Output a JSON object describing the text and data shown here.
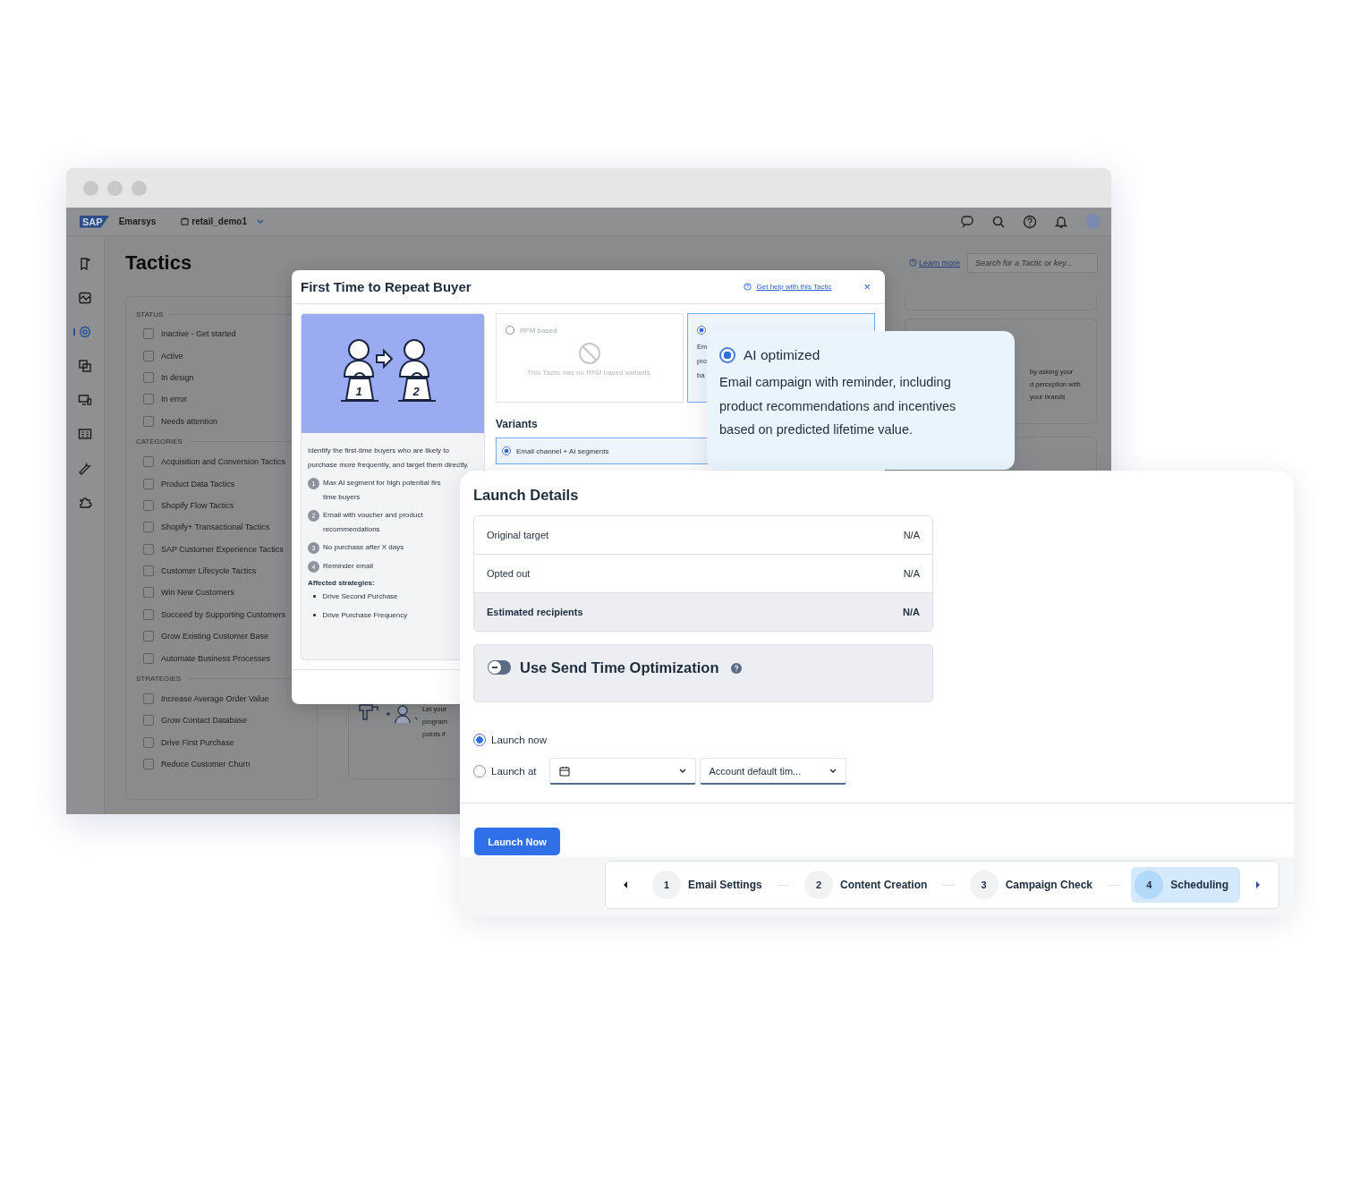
{
  "app": {
    "logo": "SAP",
    "brand": "Emarsys",
    "account": "retail_demo1",
    "title": "Tactics",
    "learn_more": "Learn more",
    "search_placeholder": "Search for a Tactic or key...",
    "nav": [
      {
        "selected": false
      },
      {
        "selected": false
      },
      {
        "selected": true
      },
      {
        "selected": false
      },
      {
        "selected": false
      },
      {
        "selected": false
      },
      {
        "selected": false
      },
      {
        "selected": false
      }
    ],
    "filter_groups": [
      {
        "heading": "STATUS",
        "items": [
          {
            "label": "Inactive - Get started",
            "checked": false
          },
          {
            "label": "Active",
            "checked": false
          },
          {
            "label": "In design",
            "checked": false
          },
          {
            "label": "In error",
            "checked": false
          },
          {
            "label": "Needs attention",
            "checked": false
          }
        ]
      },
      {
        "heading": "CATEGORIES",
        "items": [
          {
            "label": "Acquisition and Conversion Tactics",
            "checked": false
          },
          {
            "label": "Product Data Tactics",
            "checked": false
          },
          {
            "label": "Shopify Flow Tactics",
            "checked": false
          },
          {
            "label": "Shopify+ Transactional Tactics",
            "checked": false
          },
          {
            "label": "SAP Customer Experience Tactics",
            "checked": false
          },
          {
            "label": "Customer Lifecycle Tactics",
            "checked": false
          },
          {
            "label": "Win New Customers",
            "checked": false
          },
          {
            "label": "Succeed by Supporting Customers",
            "checked": false
          },
          {
            "label": "Grow Existing Customer Base",
            "checked": false
          },
          {
            "label": "Automate Business Processes",
            "checked": false
          }
        ]
      },
      {
        "heading": "STRATEGIES",
        "items": [
          {
            "label": "Increase Average Order Value",
            "checked": false
          },
          {
            "label": "Grow Contact Database",
            "checked": false
          },
          {
            "label": "Drive First Purchase",
            "checked": false
          },
          {
            "label": "Reduce Customer Churn",
            "checked": false
          }
        ]
      }
    ],
    "right_card_lines": [
      "by asking your",
      "d perception with",
      "your brands"
    ],
    "left_card_lines": [
      "Let your",
      "program",
      "points if"
    ]
  },
  "modal": {
    "title": "First Time to Repeat Buyer",
    "help_link": "Get help with this Tactic",
    "close": "×",
    "illustration_labels": [
      "1",
      "2"
    ],
    "description": "Identify the first-time buyers who are likely to purchase more frequently, and target them directly.",
    "steps": [
      {
        "number": "1",
        "lines": [
          "Max AI segment for high potential firs",
          "time buyers"
        ]
      },
      {
        "number": "2",
        "lines": [
          "Email with voucher and product",
          "recommendations"
        ]
      },
      {
        "number": "3",
        "lines": [
          "No purchase after X days"
        ]
      },
      {
        "number": "4",
        "lines": [
          "Reminder email"
        ]
      }
    ],
    "affected_heading": "Affected strategies:",
    "strategies": [
      "Drive Second Purchase",
      "Drive Purchase Frequency"
    ],
    "rfm": {
      "label": "RFM based",
      "selected": false,
      "empty_text": "This Tactic has no RFM based variants."
    },
    "ai_card": {
      "selected": true,
      "lines": [
        "Em",
        "pro",
        "ba"
      ]
    },
    "variants_heading": "Variants",
    "variants": [
      {
        "label": "Email channel + AI segments",
        "selected": true
      }
    ]
  },
  "popup": {
    "label": "AI optimized",
    "selected": true,
    "text": "Email campaign with reminder, including product recommendations and incentives based on predicted lifetime value."
  },
  "launch": {
    "title": "Launch Details",
    "rows": [
      {
        "label": "Original target",
        "value": "N/A",
        "total": false
      },
      {
        "label": "Opted out",
        "value": "N/A",
        "total": false
      },
      {
        "label": "Estimated recipients",
        "value": "N/A",
        "total": true
      }
    ],
    "sto": {
      "label": "Use Send Time Optimization",
      "on": false
    },
    "options": [
      {
        "kind": "plain",
        "label": "Launch now",
        "selected": true
      },
      {
        "kind": "datetime",
        "label": "Launch at",
        "selected": false
      }
    ],
    "timezone": "Account default tim...",
    "button": "Launch Now",
    "steps": [
      {
        "number": "1",
        "label": "Email Settings",
        "selected": false
      },
      {
        "number": "2",
        "label": "Content Creation",
        "selected": false
      },
      {
        "number": "3",
        "label": "Campaign Check",
        "selected": false
      },
      {
        "number": "4",
        "label": "Scheduling",
        "selected": true
      }
    ]
  }
}
